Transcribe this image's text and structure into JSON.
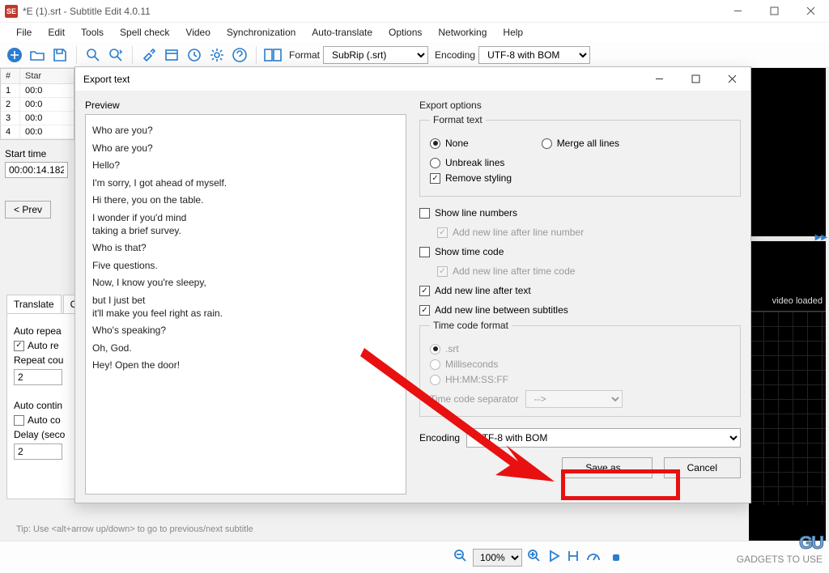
{
  "window": {
    "icon_text": "SE",
    "title": "*E (1).srt - Subtitle Edit 4.0.11"
  },
  "menu": [
    "File",
    "Edit",
    "Tools",
    "Spell check",
    "Video",
    "Synchronization",
    "Auto-translate",
    "Options",
    "Networking",
    "Help"
  ],
  "toolbar": {
    "format_label": "Format",
    "format_value": "SubRip (.srt)",
    "encoding_label": "Encoding",
    "encoding_value": "UTF-8 with BOM"
  },
  "grid": {
    "headers": {
      "num": "#",
      "start": "Star"
    },
    "rows": [
      {
        "n": "1",
        "s": "00:0"
      },
      {
        "n": "2",
        "s": "00:0"
      },
      {
        "n": "3",
        "s": "00:0"
      },
      {
        "n": "4",
        "s": "00:0"
      }
    ]
  },
  "start_time": {
    "label": "Start time",
    "value": "00:00:14.182"
  },
  "prev_btn": "< Prev",
  "tabs": {
    "translate": "Translate",
    "other": "Cr"
  },
  "translate_panel": {
    "autorepeat": "Auto repea",
    "autore": "Auto re",
    "repeat_label": "Repeat cou",
    "repeat_val": "2",
    "autocontinue": "Auto contin",
    "autoco": "Auto co",
    "delay_label": "Delay (seco",
    "delay_val": "2"
  },
  "tip": "Tip:  Use <alt+arrow up/down> to go to previous/next subtitle",
  "video_label": "video loaded",
  "player": {
    "zoom": "100%"
  },
  "dialog": {
    "title": "Export text",
    "preview_label": "Preview",
    "preview_lines": [
      "Who are you?",
      "Who are you?",
      "Hello?",
      "I'm sorry, I got ahead of myself.",
      "Hi there, you on the table.",
      "I wonder if you'd mind\ntaking a brief survey.",
      "Who is that?",
      "Five questions.",
      "Now, I know you're sleepy,",
      "but I just bet\nit'll make you feel right as rain.",
      "Who's speaking?",
      "Oh, God.",
      "Hey! Open the door!"
    ],
    "export_options_label": "Export options",
    "format_text_legend": "Format text",
    "opt_none": "None",
    "opt_merge": "Merge all lines",
    "opt_unbreak": "Unbreak lines",
    "opt_remove": "Remove styling",
    "show_line_numbers": "Show line numbers",
    "after_line_number": "Add new line after line number",
    "show_time_code": "Show time code",
    "after_time_code": "Add new line after time code",
    "add_after_text": "Add new line after text",
    "add_between": "Add new line between subtitles",
    "tc_legend": "Time code format",
    "tc_srt": ".srt",
    "tc_ms": "Milliseconds",
    "tc_hms": "HH:MM:SS:FF",
    "tc_sep_label": "Time code separator",
    "tc_sep_value": "-->",
    "enc_label": "Encoding",
    "enc_value": "UTF-8 with BOM",
    "save_as": "Save as...",
    "cancel": "Cancel"
  },
  "watermark": "GADGETS TO USE"
}
